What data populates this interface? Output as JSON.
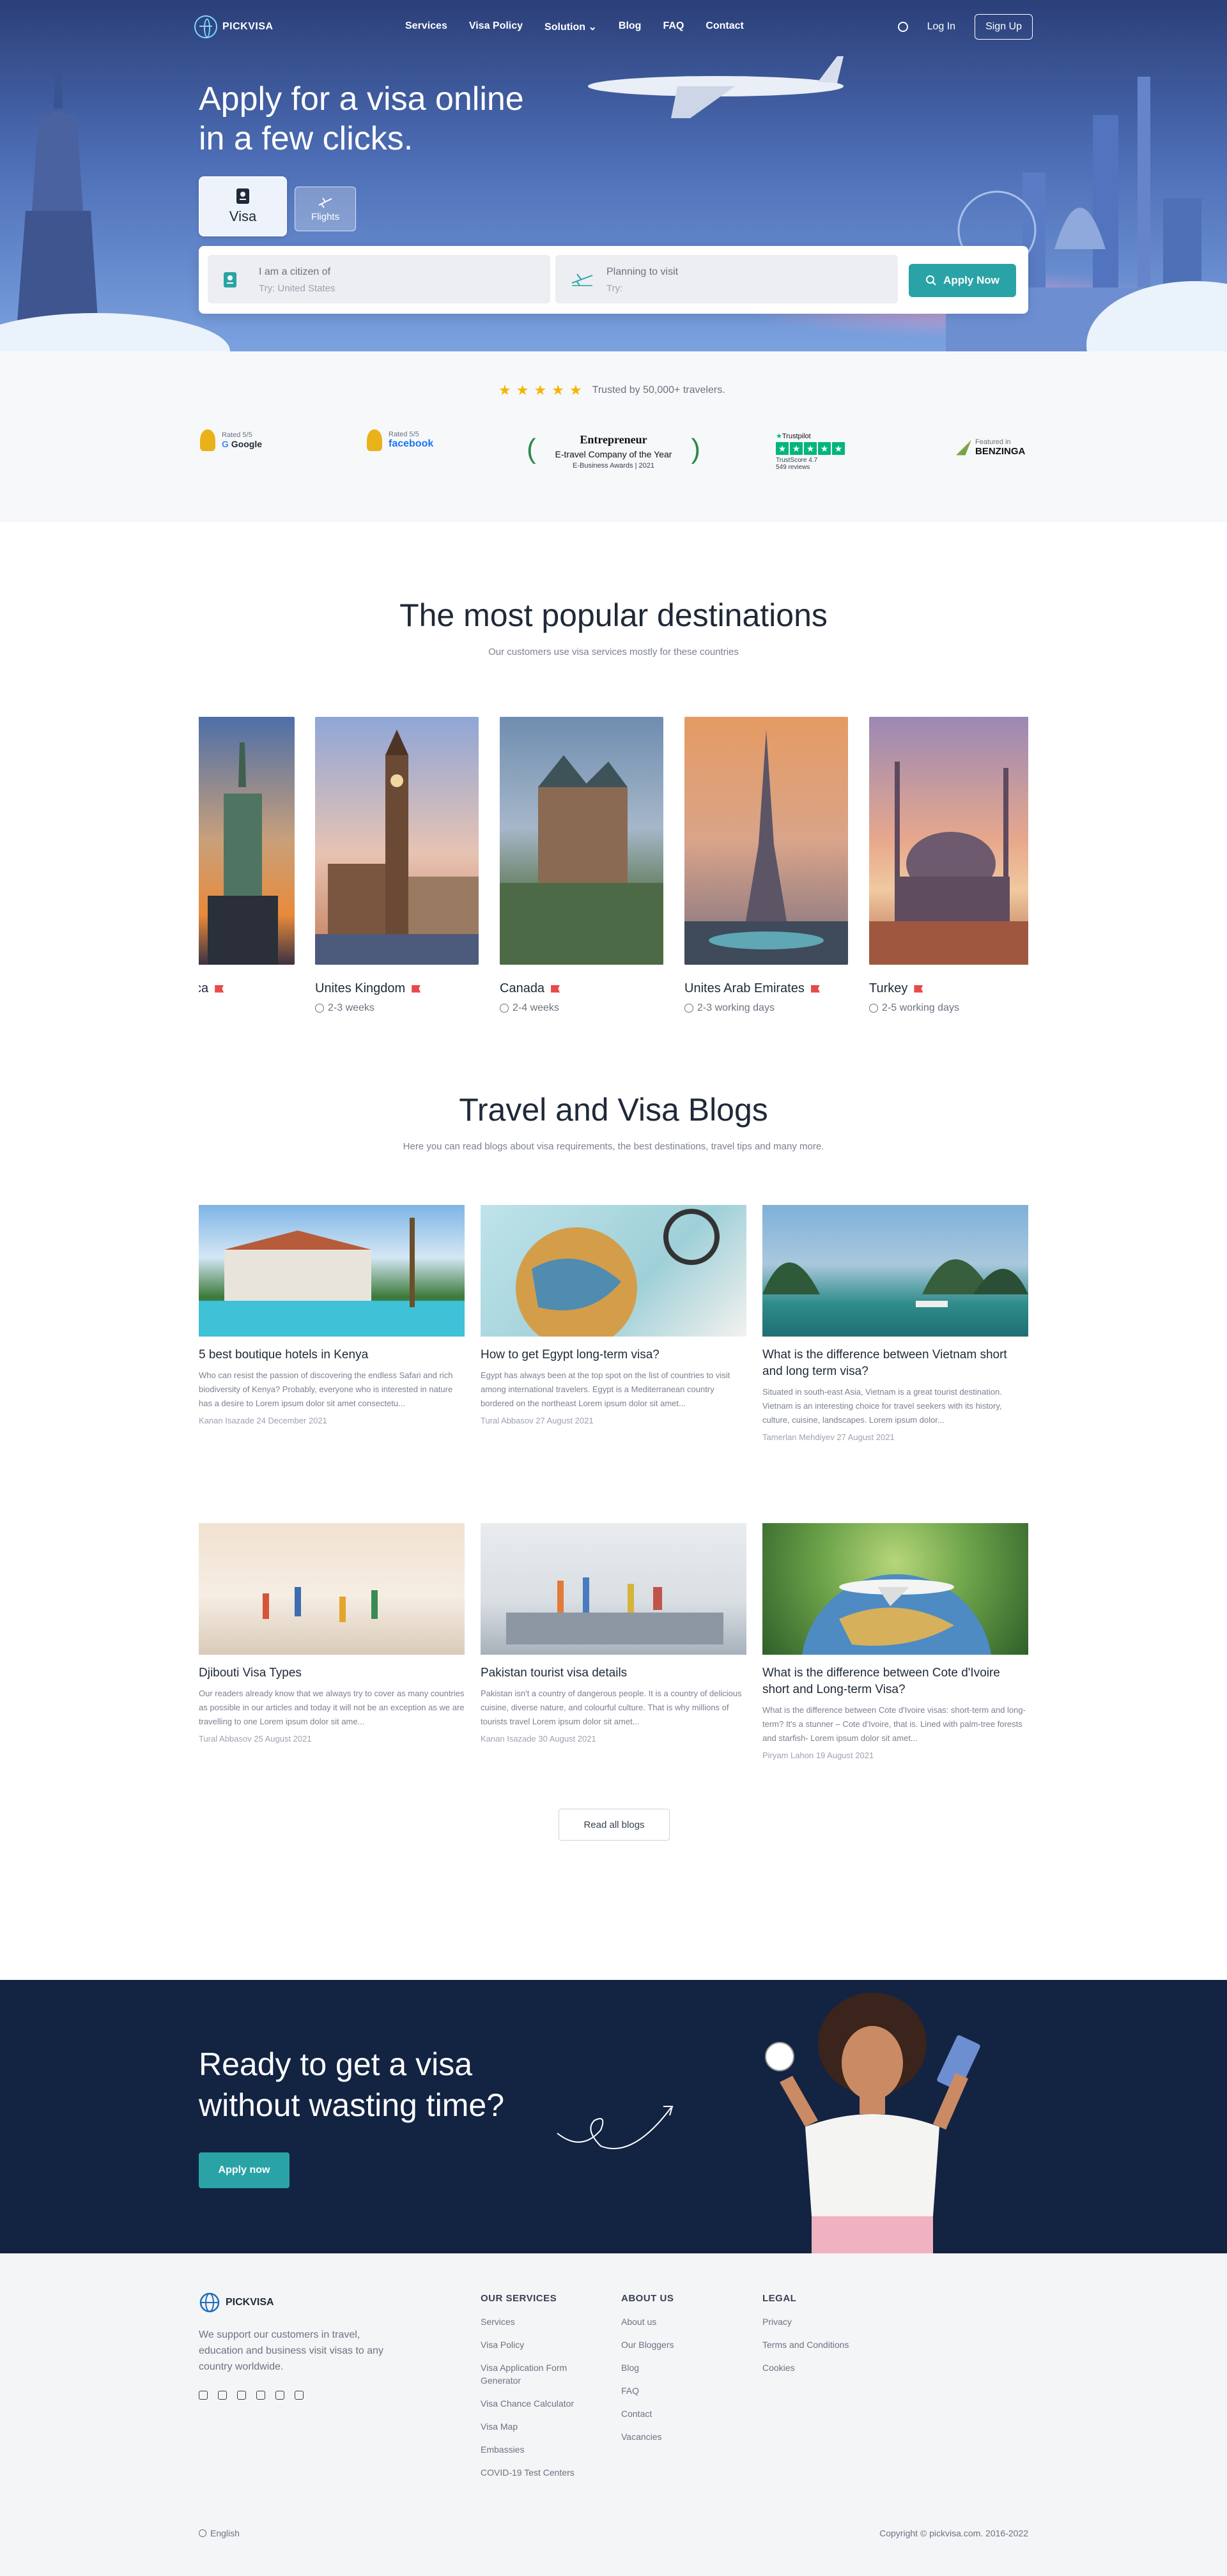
{
  "brand": {
    "name": "PICKVISA",
    "footer_name": "PICKVISA"
  },
  "nav": {
    "items": [
      "Services",
      "Visa Policy",
      "Solution",
      "Blog",
      "FAQ",
      "Contact"
    ],
    "login": "Log In",
    "signup": "Sign Up"
  },
  "hero": {
    "title_line1": "Apply for a visa online",
    "title_line2": "in a few clicks.",
    "tab_visa": "Visa",
    "tab_flights": "Flights",
    "citizen_label": "I am a citizen of",
    "citizen_placeholder": "Try: United States",
    "visit_label": "Planning to visit",
    "visit_placeholder": "Try:",
    "apply_button": "Apply Now"
  },
  "trust": {
    "text": "Trusted by 50,000+ travelers.",
    "google_rated": "Rated 5/5",
    "google_name": "Google",
    "facebook_rated": "Rated 5/5",
    "facebook_name": "facebook",
    "entre_title": "Entrepreneur",
    "entre_line": "E-travel Company of the Year",
    "entre_sub": "E-Business Awards | 2021",
    "tp_name": "Trustpilot",
    "tp_score": "TrustScore 4.7",
    "tp_reviews": "549 reviews",
    "bz_featured": "Featured in",
    "bz_name": "BENZINGA",
    "rating": 5
  },
  "destinations": {
    "title": "The most popular destinations",
    "subtitle": "Our customers use visa services mostly for these countries",
    "items": [
      {
        "name": "es of America",
        "duration": ""
      },
      {
        "name": "Unites Kingdom",
        "duration": "2-3 weeks"
      },
      {
        "name": "Canada",
        "duration": "2-4 weeks"
      },
      {
        "name": "Unites Arab Emirates",
        "duration": "2-3 working days"
      },
      {
        "name": "Turkey",
        "duration": "2-5 working days"
      }
    ]
  },
  "blogs": {
    "title": "Travel and Visa Blogs",
    "subtitle": "Here you can read blogs about visa requirements, the best destinations, travel tips and many more.",
    "items": [
      {
        "title": "5 best boutique hotels in Kenya",
        "excerpt": "Who can resist the passion of discovering the endless Safari and rich biodiversity of Kenya? Probably, everyone who is interested in nature has a desire to Lorem ipsum dolor sit amet consectetu...",
        "meta": "Kanan Isazade  24 December 2021"
      },
      {
        "title": "How to get Egypt long-term visa?",
        "excerpt": "Egypt has always been at the top spot on the list of countries to visit among international travelers. Egypt is a Mediterranean country bordered on the northeast Lorem ipsum dolor sit amet...",
        "meta": "Tural Abbasov  27 August 2021"
      },
      {
        "title": "What is the difference between Vietnam short and long term visa?",
        "excerpt": "Situated in south-east Asia, Vietnam is a great tourist destination. Vietnam is an interesting choice for travel seekers with its history, culture, cuisine, landscapes. Lorem ipsum dolor...",
        "meta": "Tamerlan Mehdiyev  27 August 2021"
      },
      {
        "title": "Djibouti Visa Types",
        "excerpt": "Our readers already know that we always try to cover as many countries as possible in our articles and today it will not be an exception as we are travelling to one Lorem ipsum dolor sit ame...",
        "meta": "Tural Abbasov  25 August 2021"
      },
      {
        "title": "Pakistan tourist visa details",
        "excerpt": "Pakistan isn't a country of dangerous people. It is a country of delicious cuisine, diverse nature, and colourful culture. That is why millions of tourists travel Lorem ipsum dolor sit amet...",
        "meta": "Kanan Isazade  30 August 2021"
      },
      {
        "title": "What is the difference between Cote d'Ivoire short and Long-term Visa?",
        "excerpt": "What is the difference between Cote d'Ivoire visas: short-term and long-term? It's a stunner – Cote d'Ivoire, that is. Lined with palm-tree forests and starfish- Lorem ipsum dolor sit amet...",
        "meta": "Piryam Lahon  19 August 2021"
      }
    ],
    "read_all": "Read all blogs"
  },
  "cta": {
    "title_line1": "Ready to get a visa",
    "title_line2": "without wasting time?",
    "button": "Apply now"
  },
  "footer": {
    "about": "We support our customers in travel, education and business visit visas to any country worldwide.",
    "services_title": "OUR SERVICES",
    "services": [
      "Services",
      "Visa Policy",
      "Visa Application Form Generator",
      "Visa Chance Calculator",
      "Visa Map",
      "Embassies",
      "COVID-19 Test Centers"
    ],
    "about_title": "ABOUT US",
    "about_links": [
      "About us",
      "Our Bloggers",
      "Blog",
      "FAQ",
      "Contact",
      "Vacancies"
    ],
    "legal_title": "LEGAL",
    "legal_links": [
      "Privacy",
      "Terms and Conditions",
      "Cookies"
    ],
    "language": "English",
    "copyright": "Copyright © pickvisa.com. 2016-2022"
  },
  "colors": {
    "accent": "#2aa3a6",
    "navy": "#132342",
    "star": "#f5b400",
    "flag": "#e84a4a"
  }
}
